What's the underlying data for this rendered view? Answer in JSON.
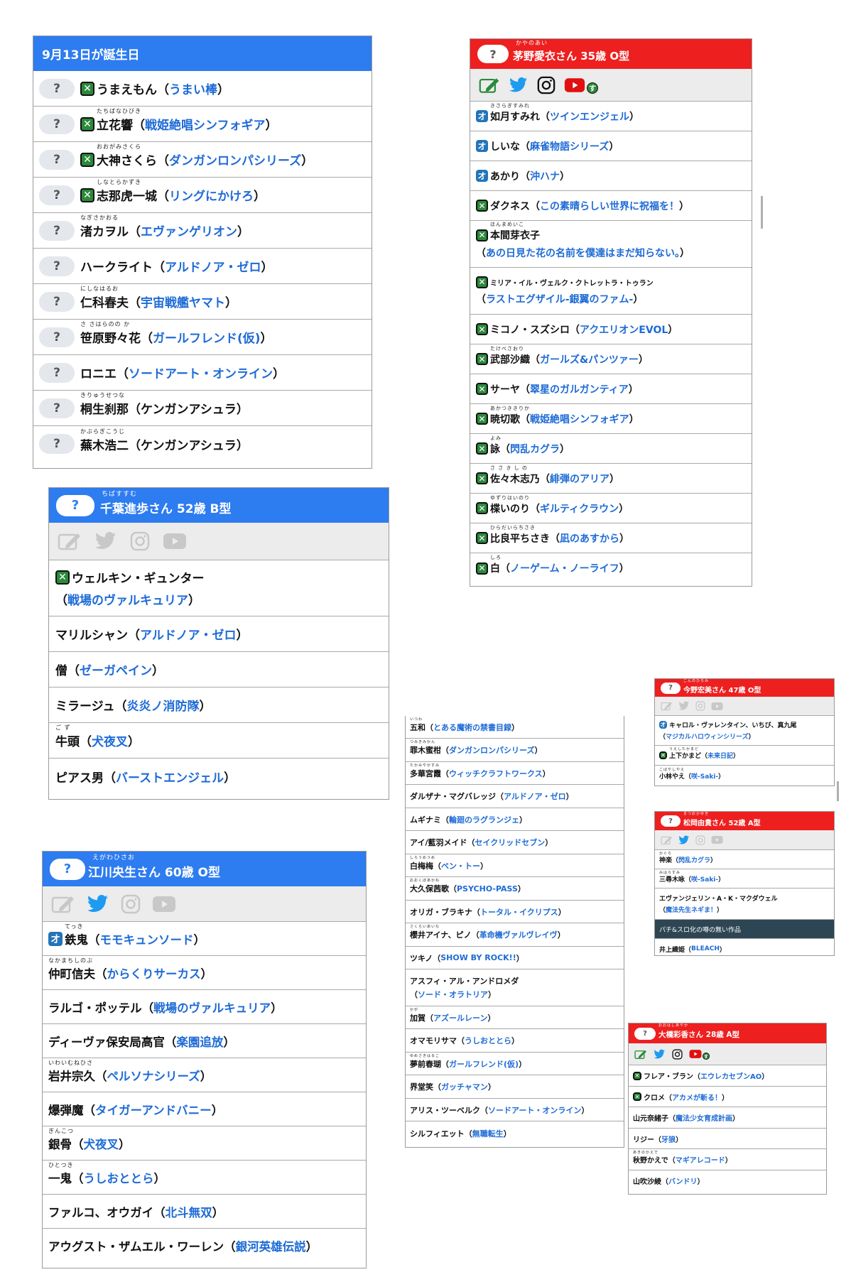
{
  "p1": {
    "title": "9月13日が誕生日",
    "rows": [
      {
        "ruby": "",
        "name": "うまえもん",
        "work": "うまい棒",
        "mark": "x",
        "q": "?"
      },
      {
        "ruby": "たちばなひびき",
        "name": "立花響",
        "work": "戦姫絶唱シンフォギア",
        "mark": "x",
        "q": "?"
      },
      {
        "ruby": "おおがみさくら",
        "name": "大神さくら",
        "work": "ダンガンロンパシリーズ",
        "mark": "x",
        "q": "?"
      },
      {
        "ruby": "しなとらかずき",
        "name": "志那虎一城",
        "work": "リングにかけろ",
        "mark": "x",
        "q": "?"
      },
      {
        "ruby": "なぎさかおる",
        "name": "渚カヲル",
        "work": "エヴァンゲリオン",
        "mark": "",
        "q": "?"
      },
      {
        "ruby": "",
        "name": "ハークライト",
        "work": "アルドノア・ゼロ",
        "mark": "",
        "q": "?"
      },
      {
        "ruby": "にしなはるお",
        "name": "仁科春夫",
        "work": "宇宙戦艦ヤマト",
        "mark": "",
        "q": "?"
      },
      {
        "ruby": "さ さはらのの か",
        "name": "笹原野々花",
        "work": "ガールフレンド(仮)",
        "mark": "",
        "q": "?"
      },
      {
        "ruby": "",
        "name": "ロニエ",
        "work": "ソードアート・オンライン",
        "mark": "",
        "q": "?"
      },
      {
        "ruby": "きりゅうせつな",
        "name": "桐生刹那",
        "work": "ケンガンアシュラ",
        "mark": "",
        "q": "?",
        "plain": true
      },
      {
        "ruby": "かぶらぎこうじ",
        "name": "蕪木浩二",
        "work": "ケンガンアシュラ",
        "mark": "",
        "q": "?",
        "plain": true
      }
    ]
  },
  "p2": {
    "q": "?",
    "ruby": "ちばすすむ",
    "title": "千葉進歩さん 52歳 B型",
    "rows": [
      {
        "name": "ウェルキン・ギュンター",
        "work": "戦場のヴァルキュリア",
        "mark": "x",
        "two": true
      },
      {
        "name": "マリルシャン",
        "work": "アルドノア・ゼロ"
      },
      {
        "name": "僧",
        "work": "ゼーガペイン"
      },
      {
        "name": "ミラージュ",
        "work": "炎炎ノ消防隊"
      },
      {
        "ruby": "ご ず",
        "name": "牛頭",
        "work": "犬夜叉"
      },
      {
        "name": "ピアス男",
        "work": "バーストエンジェル"
      }
    ]
  },
  "p3": {
    "q": "?",
    "ruby": "えがわひさお",
    "title": "江川央生さん 60歳 O型",
    "rows": [
      {
        "ruby": "てっき",
        "name": "鉄鬼",
        "work": "モモキュンソード",
        "mark": "o"
      },
      {
        "ruby": "なかまちしのぶ",
        "name": "仲町信夫",
        "work": "からくりサーカス"
      },
      {
        "name": "ラルゴ・ポッテル",
        "work": "戦場のヴァルキュリア"
      },
      {
        "name": "ディーヴァ保安局高官",
        "work": "楽園追放"
      },
      {
        "ruby": "いわいむねひさ",
        "name": "岩井宗久",
        "work": "ペルソナシリーズ"
      },
      {
        "name": "爆弾魔",
        "work": "タイガーアンドバニー"
      },
      {
        "ruby": "ぎんこつ",
        "name": "銀骨",
        "work": "犬夜叉"
      },
      {
        "ruby": "ひとつき",
        "name": "一鬼",
        "work": "うしおととら"
      },
      {
        "name": "ファルコ、オウガイ",
        "work": "北斗無双"
      },
      {
        "name": "アウグスト・ザムエル・ワーレン",
        "work": "銀河英雄伝説"
      }
    ]
  },
  "p4": {
    "q": "?",
    "ruby": "かやのあい",
    "title": "茅野愛衣さん 35歳 O型",
    "rows": [
      {
        "ruby": "きさらぎすみれ",
        "name": "如月すみれ",
        "work": "ツインエンジェル",
        "mark": "o"
      },
      {
        "name": "しいな",
        "work": "麻雀物語シリーズ",
        "mark": "o"
      },
      {
        "name": "あかり",
        "work": "沖ハナ",
        "mark": "o"
      },
      {
        "name": "ダクネス",
        "work": "この素晴らしい世界に祝福を！",
        "mark": "x"
      },
      {
        "ruby": "ほんまめいこ",
        "name": "本間芽衣子",
        "work": "あの日見た花の名前を僕達はまだ知らない。",
        "mark": "x",
        "two": true
      },
      {
        "name": "ミリア・イル・ヴェルク・クトレットラ・トゥラン",
        "work": "ラストエグザイル-銀翼のファム-",
        "mark": "x",
        "two": true,
        "small": true
      },
      {
        "name": "ミコノ・スズシロ",
        "work": "アクエリオンEVOL",
        "mark": "x"
      },
      {
        "ruby": "たけべさおり",
        "name": "武部沙織",
        "work": "ガールズ&パンツァー",
        "mark": "x"
      },
      {
        "name": "サーヤ",
        "work": "翠星のガルガンティア",
        "mark": "x"
      },
      {
        "ruby": "あかつききりか",
        "name": "暁切歌",
        "work": "戦姫絶唱シンフォギア",
        "mark": "x"
      },
      {
        "ruby": "よみ",
        "name": "詠",
        "work": "閃乱カグラ",
        "mark": "x"
      },
      {
        "ruby": "さ さ き し の",
        "name": "佐々木志乃",
        "work": "緋弾のアリア",
        "mark": "x"
      },
      {
        "ruby": "ゆずりはいのり",
        "name": "楪いのり",
        "work": "ギルティクラウン",
        "mark": "x"
      },
      {
        "ruby": "ひらだいらちさき",
        "name": "比良平ちさき",
        "work": "凪のあすから",
        "mark": "x"
      },
      {
        "ruby": "しろ",
        "name": "白",
        "work": "ノーゲーム・ノーライフ",
        "mark": "x"
      }
    ]
  },
  "p5": {
    "rows": [
      {
        "ruby": "いつわ",
        "name": "五和",
        "work": "とある魔術の禁書目録"
      },
      {
        "ruby": "つみきみかん",
        "name": "罪木蜜柑",
        "work": "ダンガンロンパシリーズ"
      },
      {
        "ruby": "たかみやかすみ",
        "name": "多華宮霞",
        "work": "ウィッチクラフトワークス"
      },
      {
        "name": "ダルザナ・マグバレッジ",
        "work": "アルドノア・ゼロ"
      },
      {
        "name": "ムギナミ",
        "work": "輪廻のラグランジェ"
      },
      {
        "name": "アイ/藍羽メイド",
        "work": "セイクリッドセブン"
      },
      {
        "ruby": "しらうめうめ",
        "name": "白梅梅",
        "work": "ベン・トー"
      },
      {
        "ruby": "おおくぼあかね",
        "name": "大久保茜歌",
        "work": "PSYCHO-PASS"
      },
      {
        "name": "オリガ・ブラキナ",
        "work": "トータル・イクリプス"
      },
      {
        "ruby": "さくらいあいな",
        "name": "櫻井アイナ、ピノ",
        "work": "革命機ヴァルヴレイヴ"
      },
      {
        "name": "ツキノ",
        "work": "SHOW BY ROCK!!"
      },
      {
        "name": "アスフィ・アル・アンドロメダ",
        "work": "ソード・オラトリア",
        "two": true
      },
      {
        "ruby": "かが",
        "name": "加賀",
        "work": "アズールレーン"
      },
      {
        "name": "オマモリサマ",
        "work": "うしおととら"
      },
      {
        "ruby": "ゆめさきはるこ",
        "name": "夢前春瑚",
        "work": "ガールフレンド(仮)"
      },
      {
        "name": "界堂笑",
        "work": "ガッチャマン"
      },
      {
        "name": "アリス・ツーベルク",
        "work": "ソードアート・オンライン"
      },
      {
        "name": "シルフィエット",
        "work": "無職転生"
      }
    ]
  },
  "p6": {
    "q": "?",
    "ruby": "こんのひろみ",
    "title": "今野宏美さん 47歳 O型",
    "rows": [
      {
        "name": "キャロル・ヴァレンタイン、いちび、真九尾",
        "work": "マジカルハロウィンシリーズ",
        "mark": "o",
        "two": true
      },
      {
        "ruby": "うえしたかまど",
        "name": "上下かまど",
        "work": "未来日記",
        "mark": "x"
      },
      {
        "ruby": "こばやしやえ",
        "name": "小林やえ",
        "work": "咲-Saki-"
      }
    ]
  },
  "p7": {
    "q": "?",
    "ruby": "まつおかゆき",
    "title": "松岡由貴さん 52歳 A型",
    "rows": [
      {
        "ruby": "かぐら",
        "name": "神楽",
        "work": "閃乱カグラ"
      },
      {
        "ruby": "みはらすみ",
        "name": "三尋木咏",
        "work": "咲-Saki-"
      },
      {
        "name": "エヴァンジェリン・A・K・マクダウェル",
        "work": "魔法先生ネギま！",
        "two": true
      },
      {
        "dark": true,
        "name": "パチ&スロ化の噂の無い作品"
      },
      {
        "name": "井上織姫",
        "work": "BLEACH"
      }
    ]
  },
  "p8": {
    "q": "?",
    "ruby": "おおはしあやか",
    "title": "大橋彩香さん 28歳 A型",
    "rows": [
      {
        "name": "フレア・ブラン",
        "work": "エウレカセブンAO",
        "mark": "x"
      },
      {
        "name": "クロメ",
        "work": "アカメが斬る！",
        "mark": "x"
      },
      {
        "name": "山元奈緒子",
        "work": "魔法少女育成計画"
      },
      {
        "name": "リジー",
        "work": "牙狼"
      },
      {
        "ruby": "あきのかえで",
        "name": "秋野かえで",
        "work": "マギアレコード"
      },
      {
        "name": "山吹沙綾",
        "work": "バンドリ"
      }
    ]
  },
  "marks": {
    "x": "✕",
    "o": "オ",
    "su": "す"
  },
  "colors": {
    "blue_header": "#2d7cf0",
    "red_header": "#ee1f1f",
    "link": "#1e6bd6",
    "dark_row": "#2e4653"
  }
}
